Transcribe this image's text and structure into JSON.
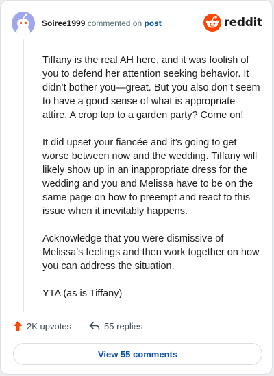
{
  "header": {
    "username": "Soiree1999",
    "action_text": "commented on",
    "target_text": "post",
    "brand": "reddit"
  },
  "comment": {
    "paragraphs": [
      "Tiffany is the real AH here, and it was foolish of you to defend her attention seeking behavior. It didn’t bother you—great. But you also don’t seem to have a good sense of what is appropriate attire. A crop top to a garden party? Come on!",
      "It did upset your fiancée and it’s going to get worse between now and the wedding. Tiffany will likely show up in an inappropriate dress for the wedding and you and Melissa have to be on the same page on how to preempt and react to this issue when it inevitably happens.",
      "Acknowledge that you were dismissive of Melissa’s feelings and then work together on how you can address the situation.",
      "YTA (as is Tiffany)"
    ]
  },
  "footer": {
    "upvotes": "2K upvotes",
    "replies": "55 replies",
    "view_button": "View 55 comments"
  },
  "colors": {
    "brand_orange": "#ff4500",
    "link_blue": "#0a4faa",
    "avatar_bg": "#9fa8ef"
  },
  "icons": {
    "avatar": "snoo-avatar-icon",
    "logo": "reddit-snoo-icon",
    "upvote": "upvote-arrow-icon",
    "reply": "reply-arrow-icon"
  }
}
